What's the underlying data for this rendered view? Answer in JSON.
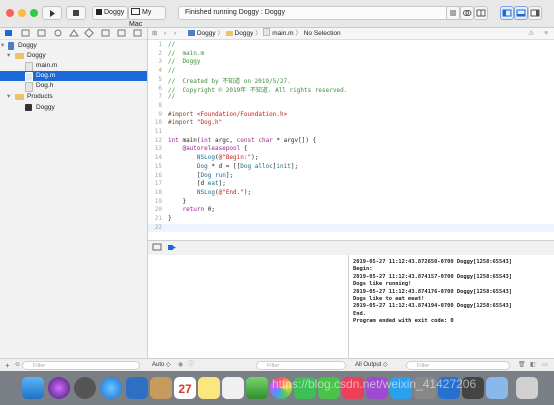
{
  "toolbar": {
    "scheme": "Doggy",
    "destination": "My Mac",
    "status": "Finished running Doggy : Doggy"
  },
  "navigator": {
    "items": [
      {
        "label": "Doggy",
        "icon": "project-icon"
      },
      {
        "label": "Doggy",
        "icon": "folder-icon"
      },
      {
        "label": "main.m",
        "icon": "m-file-icon"
      },
      {
        "label": "Dog.m",
        "icon": "m-file-icon"
      },
      {
        "label": "Dog.h",
        "icon": "h-file-icon"
      },
      {
        "label": "Products",
        "icon": "folder-icon"
      },
      {
        "label": "Doggy",
        "icon": "executable-icon"
      }
    ],
    "filter_placeholder": "Filter"
  },
  "jumpbar": {
    "crumbs": [
      "Doggy",
      "Doggy",
      "main.m",
      "No Selection"
    ]
  },
  "editor": {
    "lines": [
      {
        "n": "1",
        "text": "//"
      },
      {
        "n": "2",
        "text": "//  main.m"
      },
      {
        "n": "3",
        "text": "//  Doggy"
      },
      {
        "n": "4",
        "text": "//"
      },
      {
        "n": "5",
        "text": "//  Created by 不知道 on 2019/5/27."
      },
      {
        "n": "6",
        "text": "//  Copyright © 2019年 不知道. All rights reserved."
      },
      {
        "n": "7",
        "text": "//"
      },
      {
        "n": "8",
        "text": ""
      },
      {
        "n": "9",
        "text": "#import <Foundation/Foundation.h>"
      },
      {
        "n": "10",
        "text": "#import \"Dog.h\""
      },
      {
        "n": "11",
        "text": ""
      },
      {
        "n": "12",
        "text": "int main(int argc, const char * argv[]) {"
      },
      {
        "n": "13",
        "text": "    @autoreleasepool {"
      },
      {
        "n": "14",
        "text": "        NSLog(@\"Begin:\");"
      },
      {
        "n": "15",
        "text": "        Dog * d = [[Dog alloc]init];"
      },
      {
        "n": "16",
        "text": "        [Dog run];"
      },
      {
        "n": "17",
        "text": "        [d eat];"
      },
      {
        "n": "18",
        "text": "        NSLog(@\"End.\");"
      },
      {
        "n": "19",
        "text": "    }"
      },
      {
        "n": "20",
        "text": "    return 0;"
      },
      {
        "n": "21",
        "text": "}"
      },
      {
        "n": "22",
        "text": ""
      }
    ]
  },
  "debug": {
    "auto_label": "Auto ◇",
    "filter_placeholder": "Filter",
    "output_label": "All Output ◇",
    "console_filter_placeholder": "Filter"
  },
  "console": {
    "lines": [
      "2019-05-27 11:12:43.872650-0700 Doggy[1258:65543]",
      "Begin:",
      "2019-05-27 11:12:43.874157-0700 Doggy[1258:65543]",
      "Dogs like running!",
      "2019-05-27 11:12:43.874176-0700 Doggy[1258:65543]",
      "Dogs like to eat meat!",
      "2019-05-27 11:12:43.874194-0700 Doggy[1258:65543]",
      "End.",
      "Program ended with exit code: 0"
    ]
  },
  "watermark": "https://blog.csdn.net/weixin_41427206",
  "dock": {
    "calendar_day": "27"
  },
  "colors": {
    "selection": "#1a69d8",
    "comment": "#3d8b3d",
    "keyword": "#9b2393",
    "string": "#c41a16"
  }
}
